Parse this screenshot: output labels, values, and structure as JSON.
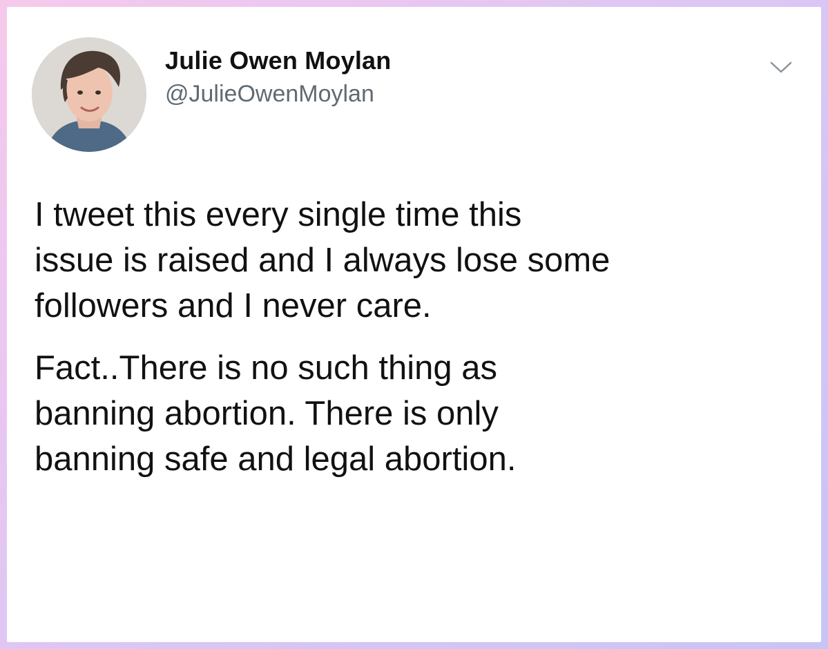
{
  "tweet": {
    "author": {
      "display_name": "Julie Owen Moylan",
      "handle": "@JulieOwenMoylan",
      "avatar_icon": "profile-photo"
    },
    "menu_icon": "chevron-down-icon",
    "paragraphs": [
      "I tweet this every single time this\nissue is raised and I always lose some\nfollowers and I never care.",
      "Fact..There is no such thing as\nbanning abortion. There is only\nbanning safe and legal abortion."
    ]
  },
  "colors": {
    "text": "#111111",
    "handle": "#5f6a73",
    "border_gradient_start": "#f6c9ec",
    "border_gradient_end": "#c9c4f6"
  }
}
